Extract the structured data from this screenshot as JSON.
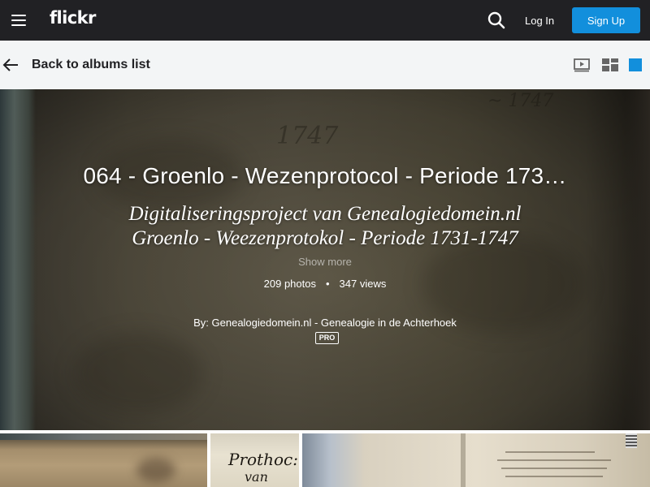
{
  "topbar": {
    "logo": "flickr",
    "login_label": "Log In",
    "signup_label": "Sign Up",
    "icons": [
      "menu-icon",
      "search-icon"
    ]
  },
  "subnav": {
    "back_label": "Back to albums list",
    "view_icons": [
      "slideshow-icon",
      "grid-view-icon",
      "single-view-icon"
    ],
    "active_color": "#128fdc"
  },
  "album": {
    "title": "064 - Groenlo - Wezenprotocol - Periode 173…",
    "description_line1": "Digitaliseringsproject van Genealogiedomein.nl",
    "description_line2": "Groenlo - Weezenprotokol - Periode 1731-1747",
    "show_more": "Show more",
    "photos": "209 photos",
    "separator": "•",
    "views": "347 views",
    "by_prefix": "By: ",
    "owner": "Genealogiedomein.nl - Genealogie in de Achterhoek",
    "badge": "PRO"
  },
  "thumbnails": {
    "t2_text1": "Prothoc:",
    "t2_text2": "van"
  },
  "colors": {
    "topbar_bg": "#212124",
    "subnav_bg": "#f3f5f6",
    "brand_blue": "#128fdc"
  }
}
